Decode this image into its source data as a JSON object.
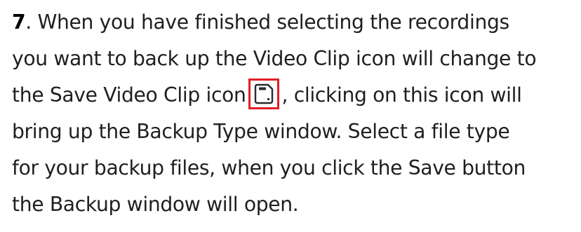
{
  "instruction": {
    "step_number": "7",
    "line1_rest": ". When you have finished selecting the recordings",
    "line2": "you want to back up the Video Clip icon will change to",
    "line3_before": "the Save Video Clip icon",
    "line3_after": ", clicking on this icon will",
    "line4": "bring up the Backup Type window. Select a file type",
    "line5": "for your backup files,  when you click the Save button",
    "line6": "the Backup window will open.",
    "icon": "save-video-clip-icon",
    "highlight_color": "#e11d27"
  }
}
